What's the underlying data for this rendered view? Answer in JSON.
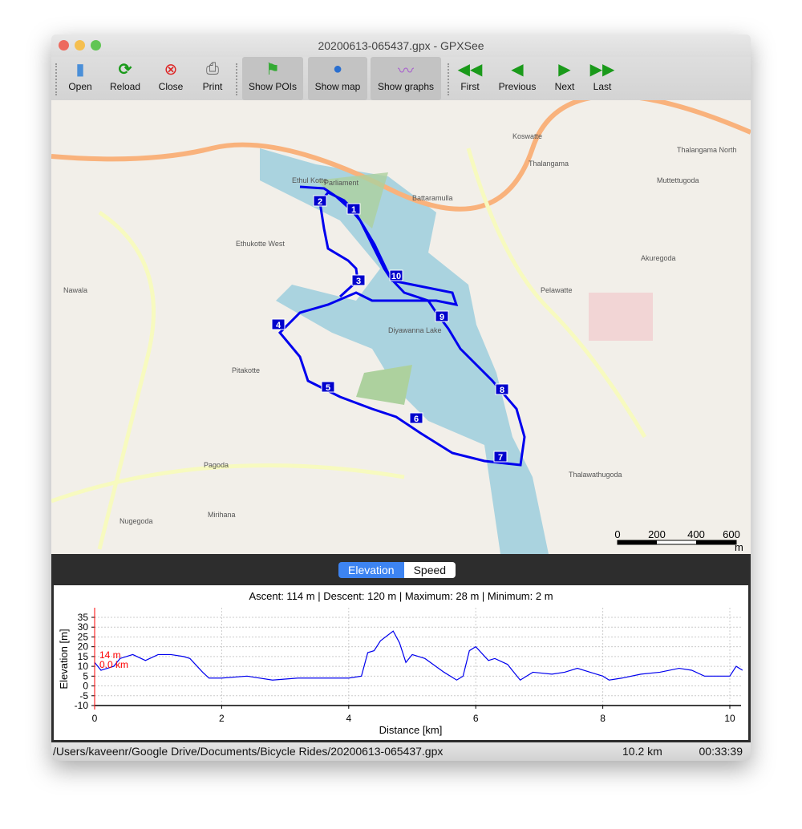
{
  "window": {
    "title": "20200613-065437.gpx - GPXSee"
  },
  "toolbar": {
    "open": "Open",
    "reload": "Reload",
    "close": "Close",
    "print": "Print",
    "show_pois": "Show POIs",
    "show_map": "Show map",
    "show_graphs": "Show graphs",
    "first": "First",
    "previous": "Previous",
    "next": "Next",
    "last": "Last"
  },
  "map": {
    "places": [
      "Battaramulla",
      "Ethul Kotte",
      "Nawala",
      "Pitakotte",
      "Pelawatte",
      "Thalawathugoda",
      "Akuregoda",
      "Thalangama",
      "Koswatte",
      "Nugegoda",
      "Mirihana",
      "Pagoda",
      "Thalangama North",
      "Muttettugoda",
      "Ethukotte West",
      "Parliament",
      "Diyawanna Lake"
    ],
    "waypoints": [
      "1",
      "2",
      "3",
      "4",
      "5",
      "6",
      "7",
      "8",
      "9",
      "10"
    ],
    "scale": {
      "ticks": [
        "0",
        "200",
        "400",
        "600"
      ],
      "unit": "m"
    },
    "colors": {
      "route": "#0000ee",
      "water": "#aad3df",
      "land": "#f2efe9",
      "road": "#f7fabf"
    }
  },
  "graph": {
    "tabs": [
      "Elevation",
      "Speed"
    ],
    "active_tab": "Elevation",
    "summary": "Ascent: 114 m | Descent: 120 m | Maximum: 28 m | Minimum: 2 m",
    "cursor": {
      "elevation": "14 m",
      "distance": "0.0 km"
    },
    "chart_data": {
      "type": "line",
      "xlabel": "Distance [km]",
      "ylabel": "Elevation [m]",
      "xlim": [
        0,
        10.2
      ],
      "ylim": [
        -10,
        35
      ],
      "xticks": [
        "0",
        "2",
        "4",
        "6",
        "8",
        "10"
      ],
      "yticks": [
        "-10",
        "-5",
        "0",
        "5",
        "10",
        "15",
        "20",
        "25",
        "30",
        "35"
      ],
      "grid": true,
      "series": [
        {
          "color": "#0000ee",
          "x": [
            0,
            0.1,
            0.2,
            0.3,
            0.4,
            0.6,
            0.8,
            1.0,
            1.2,
            1.4,
            1.5,
            1.7,
            1.8,
            2.0,
            2.4,
            2.8,
            3.2,
            3.6,
            4.0,
            4.2,
            4.3,
            4.4,
            4.5,
            4.7,
            4.8,
            4.9,
            5.0,
            5.2,
            5.5,
            5.7,
            5.8,
            5.9,
            6.0,
            6.2,
            6.3,
            6.5,
            6.6,
            6.7,
            6.9,
            7.2,
            7.4,
            7.6,
            7.8,
            8.0,
            8.1,
            8.3,
            8.6,
            8.9,
            9.2,
            9.4,
            9.6,
            10.0,
            10.1,
            10.2
          ],
          "y": [
            12,
            8,
            9,
            10,
            14,
            16,
            13,
            16,
            16,
            15,
            14,
            7,
            4,
            4,
            5,
            3,
            4,
            4,
            4,
            5,
            17,
            18,
            23,
            28,
            22,
            12,
            16,
            14,
            7,
            3,
            5,
            18,
            20,
            13,
            14,
            11,
            7,
            3,
            7,
            6,
            7,
            9,
            7,
            5,
            3,
            4,
            6,
            7,
            9,
            8,
            5,
            5,
            10,
            8
          ]
        }
      ]
    }
  },
  "status": {
    "path": "/Users/kaveenr/Google Drive/Documents/Bicycle Rides/20200613-065437.gpx",
    "distance": "10.2 km",
    "time": "00:33:39"
  }
}
